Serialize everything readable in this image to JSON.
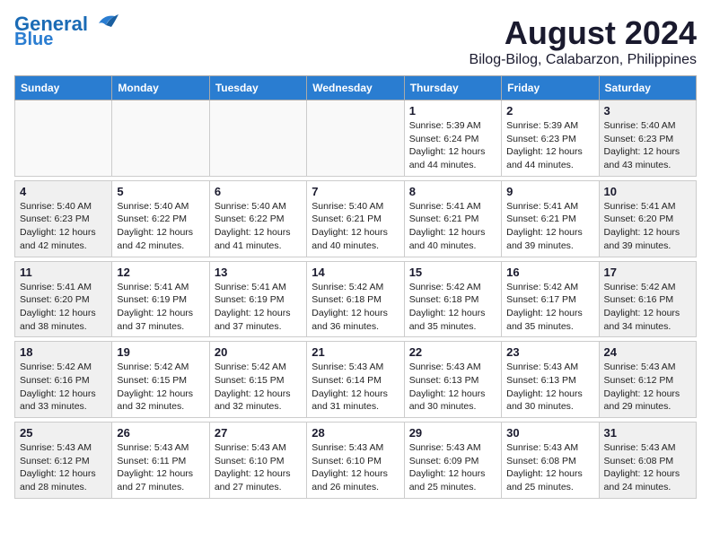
{
  "logo": {
    "line1": "General",
    "line2": "Blue"
  },
  "title": "August 2024",
  "subtitle": "Bilog-Bilog, Calabarzon, Philippines",
  "days": [
    "Sunday",
    "Monday",
    "Tuesday",
    "Wednesday",
    "Thursday",
    "Friday",
    "Saturday"
  ],
  "weeks": [
    [
      {
        "date": "",
        "info": ""
      },
      {
        "date": "",
        "info": ""
      },
      {
        "date": "",
        "info": ""
      },
      {
        "date": "",
        "info": ""
      },
      {
        "date": "1",
        "info": "Sunrise: 5:39 AM\nSunset: 6:24 PM\nDaylight: 12 hours\nand 44 minutes."
      },
      {
        "date": "2",
        "info": "Sunrise: 5:39 AM\nSunset: 6:23 PM\nDaylight: 12 hours\nand 44 minutes."
      },
      {
        "date": "3",
        "info": "Sunrise: 5:40 AM\nSunset: 6:23 PM\nDaylight: 12 hours\nand 43 minutes."
      }
    ],
    [
      {
        "date": "4",
        "info": "Sunrise: 5:40 AM\nSunset: 6:23 PM\nDaylight: 12 hours\nand 42 minutes."
      },
      {
        "date": "5",
        "info": "Sunrise: 5:40 AM\nSunset: 6:22 PM\nDaylight: 12 hours\nand 42 minutes."
      },
      {
        "date": "6",
        "info": "Sunrise: 5:40 AM\nSunset: 6:22 PM\nDaylight: 12 hours\nand 41 minutes."
      },
      {
        "date": "7",
        "info": "Sunrise: 5:40 AM\nSunset: 6:21 PM\nDaylight: 12 hours\nand 40 minutes."
      },
      {
        "date": "8",
        "info": "Sunrise: 5:41 AM\nSunset: 6:21 PM\nDaylight: 12 hours\nand 40 minutes."
      },
      {
        "date": "9",
        "info": "Sunrise: 5:41 AM\nSunset: 6:21 PM\nDaylight: 12 hours\nand 39 minutes."
      },
      {
        "date": "10",
        "info": "Sunrise: 5:41 AM\nSunset: 6:20 PM\nDaylight: 12 hours\nand 39 minutes."
      }
    ],
    [
      {
        "date": "11",
        "info": "Sunrise: 5:41 AM\nSunset: 6:20 PM\nDaylight: 12 hours\nand 38 minutes."
      },
      {
        "date": "12",
        "info": "Sunrise: 5:41 AM\nSunset: 6:19 PM\nDaylight: 12 hours\nand 37 minutes."
      },
      {
        "date": "13",
        "info": "Sunrise: 5:41 AM\nSunset: 6:19 PM\nDaylight: 12 hours\nand 37 minutes."
      },
      {
        "date": "14",
        "info": "Sunrise: 5:42 AM\nSunset: 6:18 PM\nDaylight: 12 hours\nand 36 minutes."
      },
      {
        "date": "15",
        "info": "Sunrise: 5:42 AM\nSunset: 6:18 PM\nDaylight: 12 hours\nand 35 minutes."
      },
      {
        "date": "16",
        "info": "Sunrise: 5:42 AM\nSunset: 6:17 PM\nDaylight: 12 hours\nand 35 minutes."
      },
      {
        "date": "17",
        "info": "Sunrise: 5:42 AM\nSunset: 6:16 PM\nDaylight: 12 hours\nand 34 minutes."
      }
    ],
    [
      {
        "date": "18",
        "info": "Sunrise: 5:42 AM\nSunset: 6:16 PM\nDaylight: 12 hours\nand 33 minutes."
      },
      {
        "date": "19",
        "info": "Sunrise: 5:42 AM\nSunset: 6:15 PM\nDaylight: 12 hours\nand 32 minutes."
      },
      {
        "date": "20",
        "info": "Sunrise: 5:42 AM\nSunset: 6:15 PM\nDaylight: 12 hours\nand 32 minutes."
      },
      {
        "date": "21",
        "info": "Sunrise: 5:43 AM\nSunset: 6:14 PM\nDaylight: 12 hours\nand 31 minutes."
      },
      {
        "date": "22",
        "info": "Sunrise: 5:43 AM\nSunset: 6:13 PM\nDaylight: 12 hours\nand 30 minutes."
      },
      {
        "date": "23",
        "info": "Sunrise: 5:43 AM\nSunset: 6:13 PM\nDaylight: 12 hours\nand 30 minutes."
      },
      {
        "date": "24",
        "info": "Sunrise: 5:43 AM\nSunset: 6:12 PM\nDaylight: 12 hours\nand 29 minutes."
      }
    ],
    [
      {
        "date": "25",
        "info": "Sunrise: 5:43 AM\nSunset: 6:12 PM\nDaylight: 12 hours\nand 28 minutes."
      },
      {
        "date": "26",
        "info": "Sunrise: 5:43 AM\nSunset: 6:11 PM\nDaylight: 12 hours\nand 27 minutes."
      },
      {
        "date": "27",
        "info": "Sunrise: 5:43 AM\nSunset: 6:10 PM\nDaylight: 12 hours\nand 27 minutes."
      },
      {
        "date": "28",
        "info": "Sunrise: 5:43 AM\nSunset: 6:10 PM\nDaylight: 12 hours\nand 26 minutes."
      },
      {
        "date": "29",
        "info": "Sunrise: 5:43 AM\nSunset: 6:09 PM\nDaylight: 12 hours\nand 25 minutes."
      },
      {
        "date": "30",
        "info": "Sunrise: 5:43 AM\nSunset: 6:08 PM\nDaylight: 12 hours\nand 25 minutes."
      },
      {
        "date": "31",
        "info": "Sunrise: 5:43 AM\nSunset: 6:08 PM\nDaylight: 12 hours\nand 24 minutes."
      }
    ]
  ]
}
